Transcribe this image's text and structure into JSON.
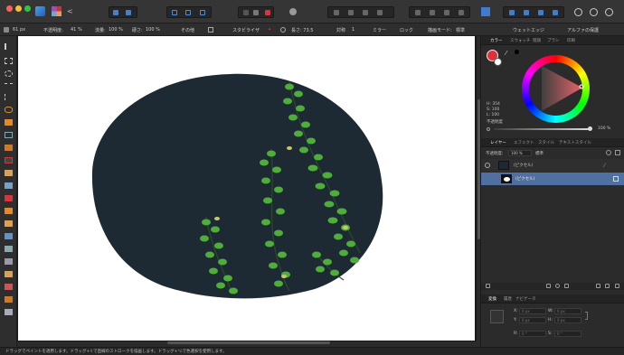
{
  "toolbar": {
    "ctx": {
      "zoom": "61 px",
      "opacity_label": "不透明度:",
      "opacity_value": "41 %",
      "flow_label": "流量:",
      "flow_value": "100 %",
      "hardness_label": "硬さ:",
      "hardness_value": "100 %",
      "more_label": "その他",
      "stabilizer_label": "スタビライザ",
      "wet_edge_label": "長さ: 73.5",
      "symmetry_label": "対称",
      "symmetry_value": "1",
      "mirror_label": "ミラー",
      "lock_label": "ロック",
      "blend_label": "描画モード:",
      "blend_value": "標準",
      "wet_edges_label": "ウェットエッジ",
      "protect_alpha_label": "アルファの保護"
    }
  },
  "panel": {
    "color_tabs": [
      "カラー",
      "スウォッチ",
      "階調",
      "ブラシ",
      "印刷"
    ],
    "hsl": {
      "h": "H: 354",
      "s": "S: 100",
      "l": "L: 100"
    },
    "opacity_label": "不透明度",
    "opacity_value": "100 %",
    "layer_tabs": [
      "レイヤー",
      "エフェクト",
      "スタイル",
      "テキストスタイル"
    ],
    "layer_opacity_label": "不透明度:",
    "layer_opacity_value": "100 %",
    "layer_blend": "標準",
    "layers": [
      {
        "name": "(ピクセル)"
      },
      {
        "name": "(ピクセル)"
      }
    ],
    "transform_tabs": [
      "変換",
      "履歴",
      "ナビゲータ"
    ],
    "transform": {
      "x_label": "X:",
      "x_value": "0 px",
      "y_label": "Y:",
      "y_value": "0 px",
      "w_label": "W:",
      "w_value": "0 px",
      "h_label": "H:",
      "h_value": "0 px",
      "r_label": "R:",
      "r_value": "0 °",
      "s_label": "S:",
      "s_value": "0 °"
    }
  },
  "status": {
    "text": "ドラッグでペイントを適用します。ドラッグ+⇧で直線のストロークを描画します。ドラッグ+⌥で色選択を使用します。"
  },
  "colors": {
    "accent": "#e0303a",
    "selection": "#5a7aa8",
    "ivy": "#4fae3a",
    "wall": "#1d2a33"
  }
}
